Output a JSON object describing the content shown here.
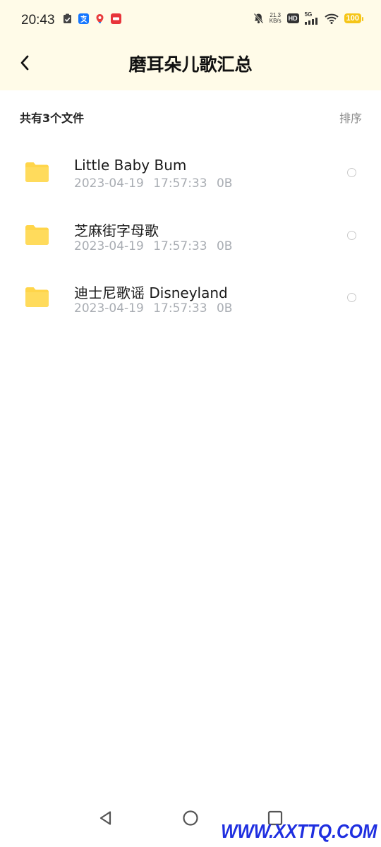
{
  "status_bar": {
    "time": "20:43",
    "net_speed_value": "21.3",
    "net_speed_unit": "KB/s",
    "hd_label": "HD",
    "network_label": "5G",
    "battery": "100",
    "battery_color": "#f5c518"
  },
  "header": {
    "title": "磨耳朵儿歌汇总",
    "background": "#fffbe8"
  },
  "summary": {
    "count_text": "共有3个文件",
    "sort_label": "排序"
  },
  "files": [
    {
      "name": "Little  Baby  Bum",
      "date": "2023-04-19",
      "time": "17:57:33",
      "size": "0B"
    },
    {
      "name": "芝麻街字母歌",
      "date": "2023-04-19",
      "time": "17:57:33",
      "size": "0B"
    },
    {
      "name": "迪士尼歌谣  Disneyland",
      "date": "2023-04-19",
      "time": "17:57:33",
      "size": "0B"
    }
  ],
  "folder_color": "#ffd54a",
  "watermark": "WWW.XXTTQ.COM"
}
